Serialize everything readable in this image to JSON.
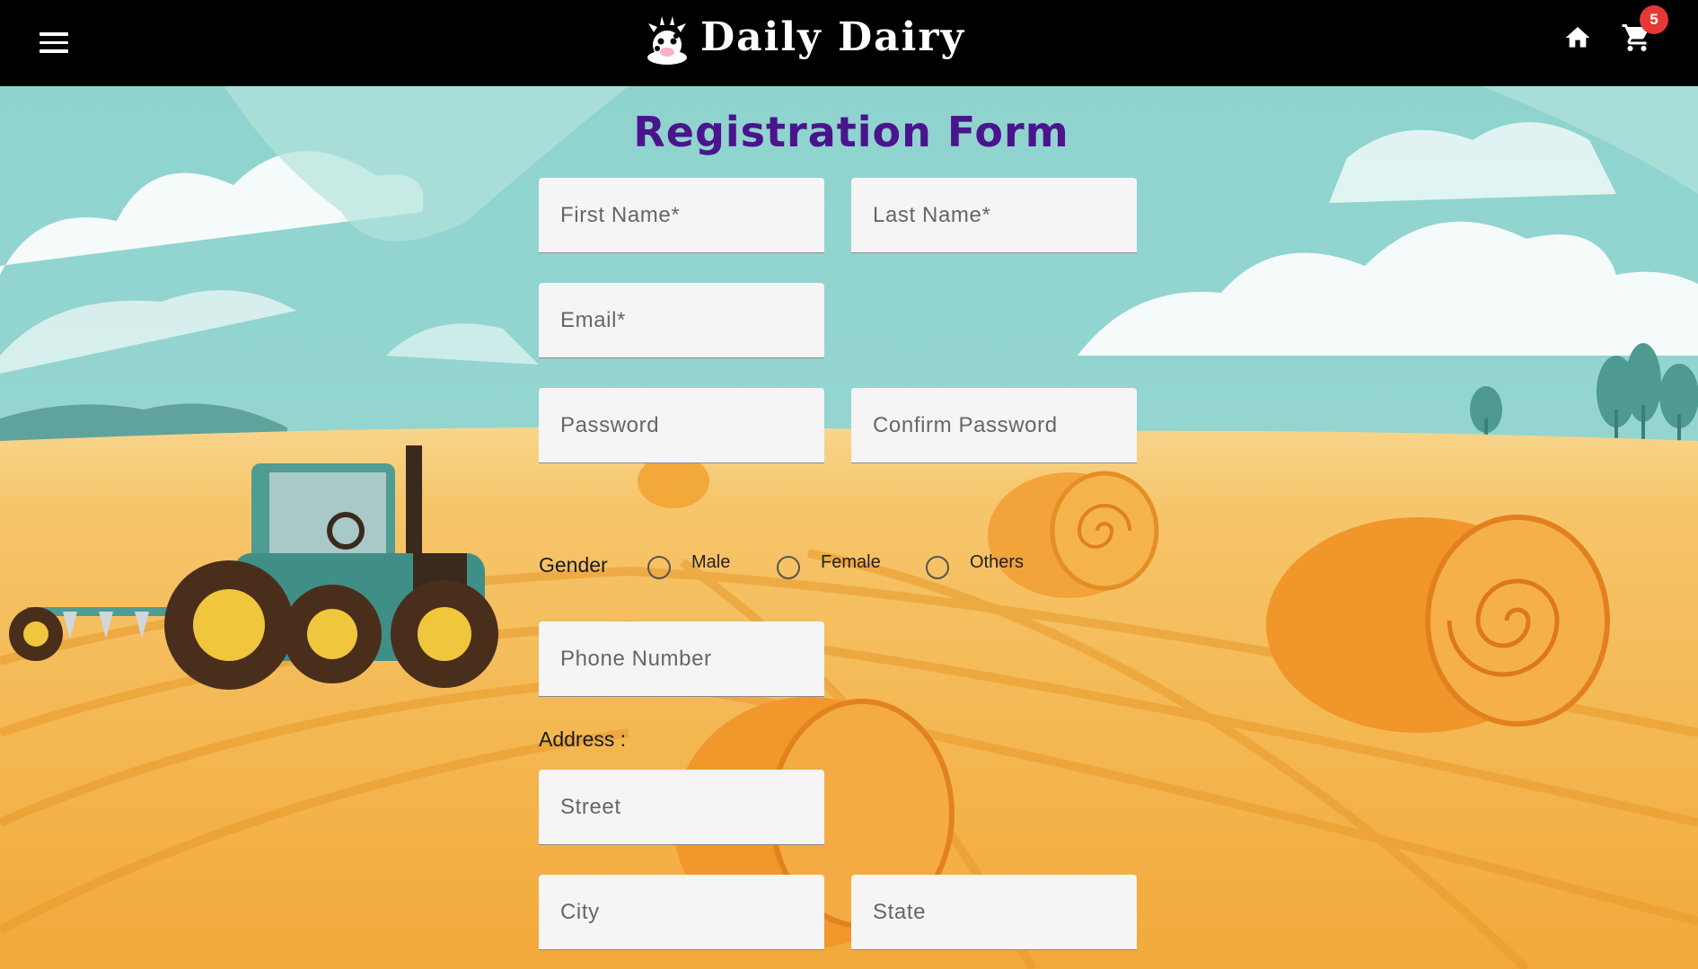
{
  "header": {
    "brand": "Daily Dairy",
    "menu_icon": "hamburger-menu-icon",
    "home_icon": "home-icon",
    "cart_icon": "shopping-cart-icon",
    "cart_count": "5",
    "background_color": "#000000",
    "badge_color": "#e53935"
  },
  "form": {
    "title": "Registration Form",
    "title_color": "#4a148c",
    "first_name_placeholder": "First Name*",
    "last_name_placeholder": "Last Name*",
    "email_placeholder": "Email*",
    "password_placeholder": "Password",
    "confirm_password_placeholder": "Confirm Password",
    "gender": {
      "label": "Gender",
      "options": [
        "Male",
        "Female",
        "Others"
      ]
    },
    "phone_placeholder": "Phone Number",
    "address": {
      "label": "Address :",
      "street_placeholder": "Street",
      "city_placeholder": "City",
      "state_placeholder": "State"
    }
  }
}
